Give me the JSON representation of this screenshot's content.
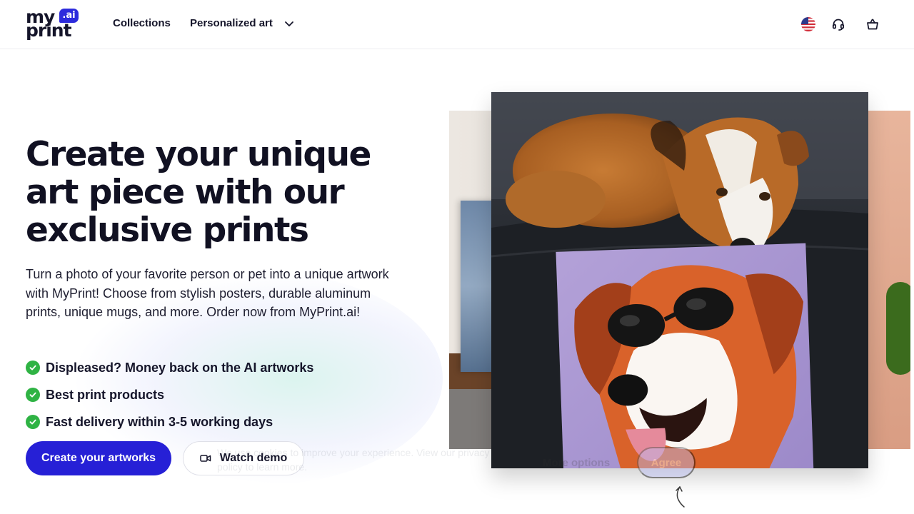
{
  "brand": {
    "logo_my": "my",
    "logo_print": "print",
    "logo_badge": ".ai",
    "accent": "#2620d6"
  },
  "nav": {
    "collections": "Collections",
    "personalized_art": "Personalized art"
  },
  "header_icons": [
    "us-flag-icon",
    "headset-icon",
    "cart-icon"
  ],
  "hero": {
    "headline": "Create your unique art piece with our exclusive prints",
    "description": "Turn a photo of your favorite person or pet into a unique artwork with MyPrint! Choose from stylish posters, durable aluminum prints, unique mugs, and more. Order now from MyPrint.ai!",
    "bullets": [
      "Displeased? Money back on the AI artworks",
      "Best print products",
      "Fast delivery within 3-5 working days"
    ],
    "cta_primary": "Create your artworks",
    "cta_secondary": "Watch demo"
  },
  "cookie_banner": {
    "text": "We use cookies to improve your experience. View our privacy policy to learn more.",
    "more_options": "More options",
    "agree": "Agree"
  },
  "colors": {
    "check": "#2fb344",
    "text": "#15152a"
  }
}
